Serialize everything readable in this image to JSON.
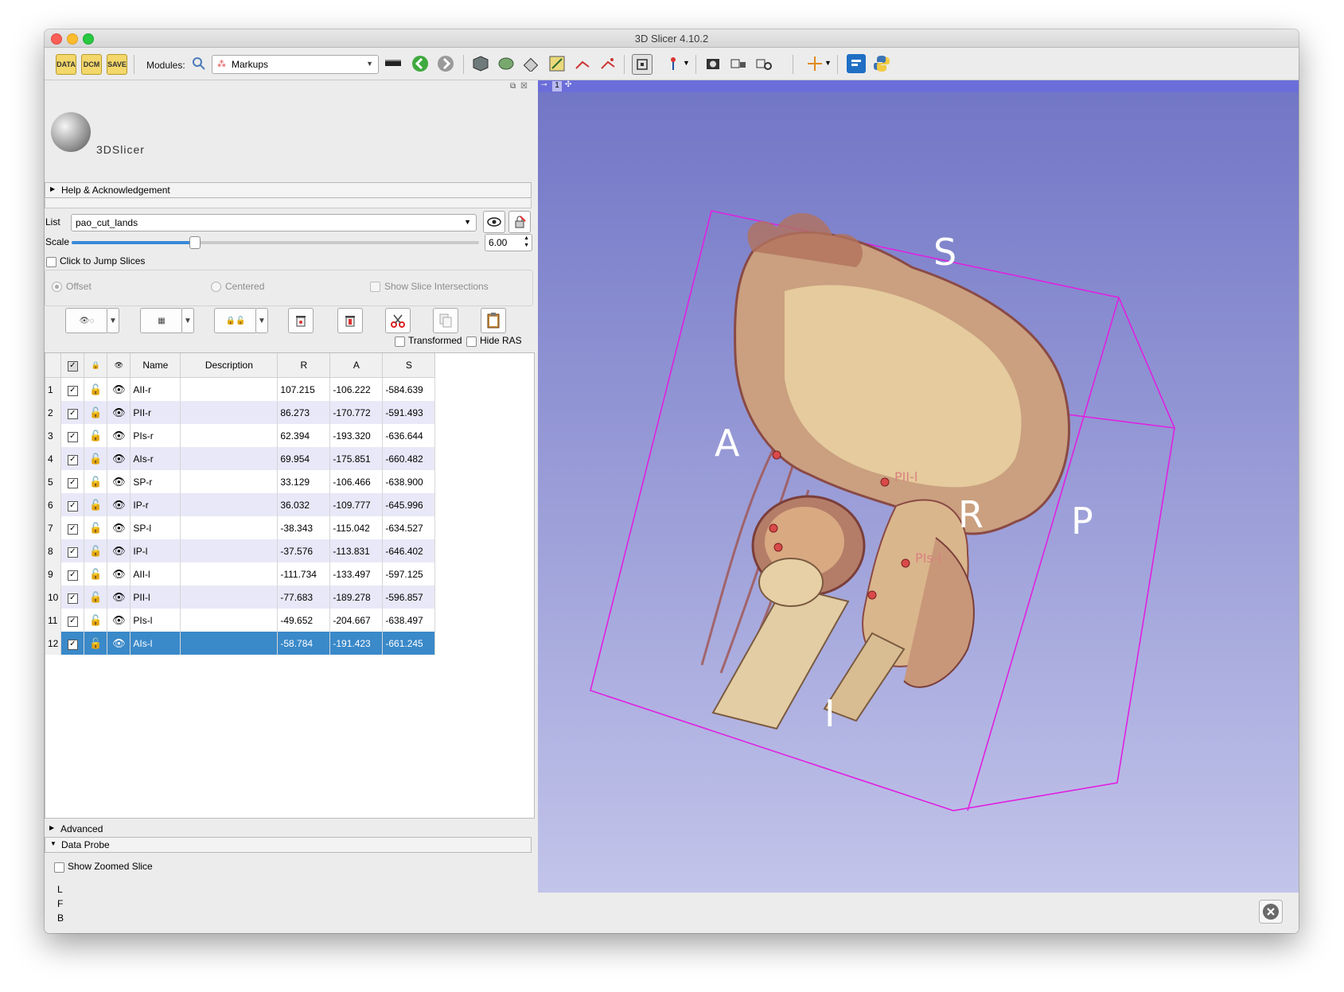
{
  "window": {
    "title": "3D Slicer 4.10.2"
  },
  "toolbar": {
    "data_label": "DATA",
    "dcm_label": "DCM",
    "save_label": "SAVE",
    "modules_label": "Modules:",
    "module_selected": "Markups"
  },
  "logo": {
    "text": "3DSlicer"
  },
  "sections": {
    "help": "Help & Acknowledgement",
    "advanced": "Advanced",
    "data_probe": "Data Probe"
  },
  "markups": {
    "list_label": "List",
    "list_value": "pao_cut_lands",
    "scale_label": "Scale",
    "scale_value": "6.00",
    "scale_fraction": 0.3,
    "click_to_jump": "Click to Jump Slices",
    "offset": "Offset",
    "centered": "Centered",
    "show_slice_intersections": "Show Slice Intersections",
    "transformed": "Transformed",
    "hide_ras": "Hide RAS"
  },
  "table": {
    "headers": [
      "Name",
      "Description",
      "R",
      "A",
      "S"
    ],
    "rows": [
      {
        "n": "1",
        "name": "AII-r",
        "r": "107.215",
        "a": "-106.222",
        "s": "-584.639"
      },
      {
        "n": "2",
        "name": "PII-r",
        "r": "86.273",
        "a": "-170.772",
        "s": "-591.493"
      },
      {
        "n": "3",
        "name": "PIs-r",
        "r": "62.394",
        "a": "-193.320",
        "s": "-636.644"
      },
      {
        "n": "4",
        "name": "AIs-r",
        "r": "69.954",
        "a": "-175.851",
        "s": "-660.482"
      },
      {
        "n": "5",
        "name": "SP-r",
        "r": "33.129",
        "a": "-106.466",
        "s": "-638.900"
      },
      {
        "n": "6",
        "name": "IP-r",
        "r": "36.032",
        "a": "-109.777",
        "s": "-645.996"
      },
      {
        "n": "7",
        "name": "SP-l",
        "r": "-38.343",
        "a": "-115.042",
        "s": "-634.527"
      },
      {
        "n": "8",
        "name": "IP-l",
        "r": "-37.576",
        "a": "-113.831",
        "s": "-646.402"
      },
      {
        "n": "9",
        "name": "AII-l",
        "r": "-111.734",
        "a": "-133.497",
        "s": "-597.125"
      },
      {
        "n": "10",
        "name": "PII-l",
        "r": "-77.683",
        "a": "-189.278",
        "s": "-596.857"
      },
      {
        "n": "11",
        "name": "PIs-l",
        "r": "-49.652",
        "a": "-204.667",
        "s": "-638.497"
      },
      {
        "n": "12",
        "name": "AIs-l",
        "r": "-58.784",
        "a": "-191.423",
        "s": "-661.245"
      }
    ]
  },
  "data_probe": {
    "show_zoomed_slice": "Show Zoomed Slice",
    "lines": [
      "L",
      "F",
      "B"
    ]
  },
  "view3d": {
    "tab_number": "1",
    "orient_labels": {
      "S": "S",
      "A": "A",
      "R": "R",
      "P": "P",
      "I": "I"
    },
    "fiducial_labels": [
      "PII-l",
      "PIs-l"
    ],
    "background_top": "#7276c6",
    "background_bottom": "#c2c4ea",
    "box_color": "#e020e0",
    "fiducial_color": "#d94a4a"
  }
}
